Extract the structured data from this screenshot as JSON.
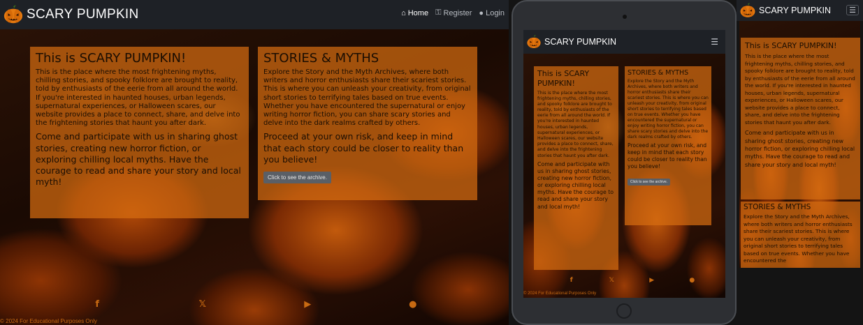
{
  "brand": {
    "name": "SCARY PUMPKIN",
    "logo_icon": "pumpkin-icon"
  },
  "nav": {
    "items": [
      {
        "label": "Home",
        "icon": "home-icon"
      },
      {
        "label": "Register",
        "icon": "key-icon"
      },
      {
        "label": "Login",
        "icon": "user-icon"
      }
    ],
    "menu_icon": "hamburger-icon"
  },
  "intro": {
    "title": "This is SCARY PUMPKIN!",
    "paragraph1": "This is the place where the most frightening myths, chilling stories, and spooky folklore are brought to reality, told by enthusiasts of the eerie from all around the world. If you're interested in haunted houses, urban legends, supernatural experiences, or Halloween scares, our website provides a place to connect, share, and delve into the frightening stories that haunt you after dark.",
    "paragraph2": "Come and participate with us in sharing ghost stories, creating new horror fiction, or exploring chilling local myths. Have the courage to read and share your story and local myth!"
  },
  "stories": {
    "title": "STORIES & MYTHS",
    "paragraph1": "Explore the Story and the Myth Archives, where both writers and horror enthusiasts share their scariest stories. This is where you can unleash your creativity, from original short stories to terrifying tales based on true events. Whether you have encountered the supernatural or enjoy writing horror fiction, you can share scary stories and delve into the dark realms crafted by others.",
    "paragraph2": "Proceed at your own risk, and keep in mind that each story could be closer to reality than you believe!",
    "button_label": "Click to see the archive.",
    "mobile_excerpt": "Explore the Story and the Myth Archives, where both writers and horror enthusiasts share their scariest stories. This is where you can unleash your creativity, from original short stories to terrifying tales based on true events. Whether you have encountered the"
  },
  "footer": {
    "text": "© 2024 For Educational Purposes Only",
    "social": [
      {
        "icon": "facebook-icon",
        "glyph": "f"
      },
      {
        "icon": "x-icon",
        "glyph": "𝕏"
      },
      {
        "icon": "youtube-icon",
        "glyph": "▶"
      },
      {
        "icon": "github-icon",
        "glyph": "●"
      }
    ]
  },
  "colors": {
    "accent": "#c86a12",
    "card": "#d66c10",
    "navbar": "#1e2126"
  }
}
